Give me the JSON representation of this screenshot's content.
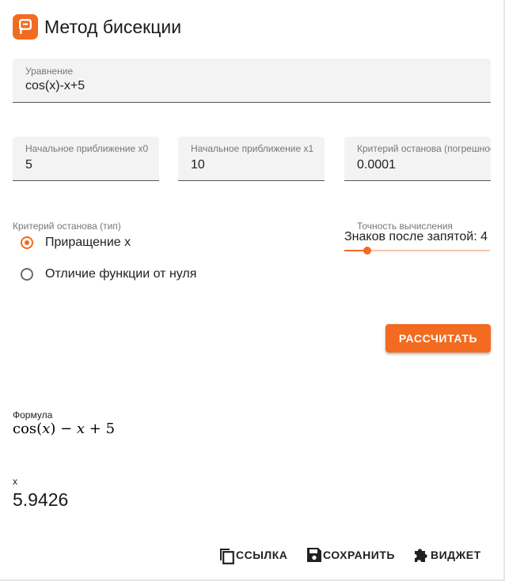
{
  "app": {
    "title": "Метод бисекции",
    "logo_icon": "p-logo-icon",
    "accent_color": "#f26b21"
  },
  "equation": {
    "label": "Уравнение",
    "value": "cos(x)-x+5"
  },
  "inputs": {
    "x0": {
      "label": "Начальное приближение x0",
      "value": "5"
    },
    "x1": {
      "label": "Начальное приближение x1",
      "value": "10"
    },
    "eps": {
      "label": "Критерий останова (погрешность)",
      "value": "0.0001"
    }
  },
  "stop_criterion": {
    "label": "Критерий останова (тип)",
    "options": [
      {
        "label": "Приращение x",
        "selected": true
      },
      {
        "label": "Отличие функции от нуля",
        "selected": false
      }
    ]
  },
  "precision": {
    "label": "Точность вычисления",
    "text": "Знаков после запятой: 4",
    "value": 4,
    "min": 1,
    "max": 20
  },
  "calculate_button": {
    "label": "РАССЧИТАТЬ"
  },
  "result": {
    "formula_label": "Формула",
    "formula": "cos(x) − x + 5",
    "x_label": "x",
    "x_value": "5.9426"
  },
  "footer": {
    "link_label": "ССЫЛКА",
    "save_label": "СОХРАНИТЬ",
    "widget_label": "ВИДЖЕТ",
    "link_icon": "copy-icon",
    "save_icon": "save-icon",
    "widget_icon": "puzzle-icon"
  }
}
